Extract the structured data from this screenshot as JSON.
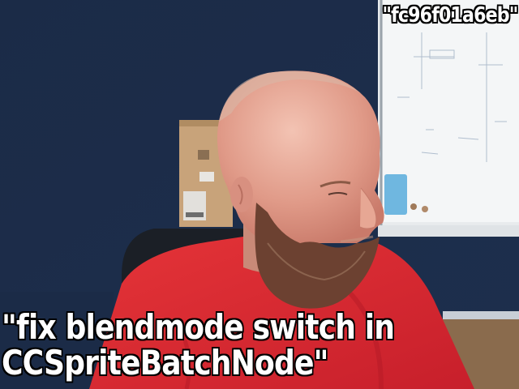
{
  "overlay": {
    "commit_hash": "\"fc96f01a6eb\"",
    "commit_message_line1": "\"fix blendmode switch in",
    "commit_message_line2": "CCSpriteBatchNode\""
  },
  "colors": {
    "wall": "#1c2d4a",
    "whiteboard": "#f1f3f4",
    "shirt": "#d8262f",
    "skin": "#e3a291",
    "beard": "#6b4030",
    "box": "#c9a57c",
    "floor": "#8a6b4d"
  }
}
